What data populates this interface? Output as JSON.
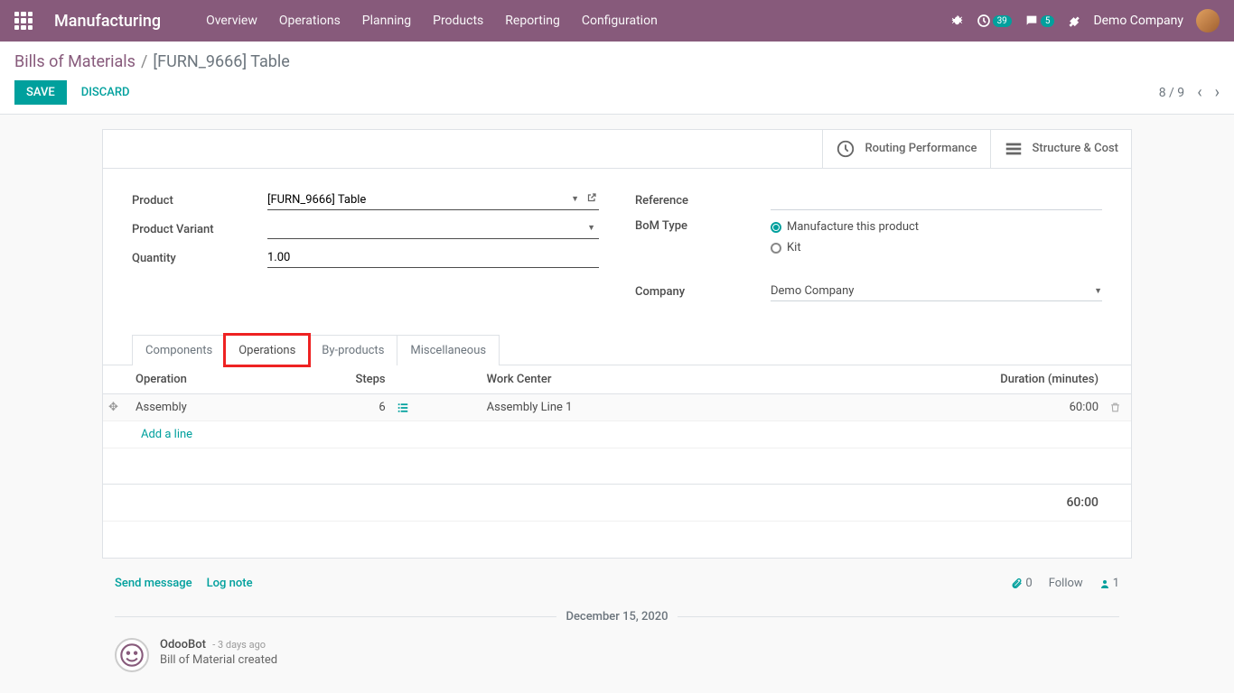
{
  "nav": {
    "brand": "Manufacturing",
    "menu": [
      "Overview",
      "Operations",
      "Planning",
      "Products",
      "Reporting",
      "Configuration"
    ],
    "badge_clock": "39",
    "badge_chat": "5",
    "company": "Demo Company"
  },
  "breadcrumb": {
    "root": "Bills of Materials",
    "current": "[FURN_9666] Table"
  },
  "buttons": {
    "save": "SAVE",
    "discard": "DISCARD"
  },
  "pager": {
    "text": "8 / 9"
  },
  "stat_buttons": {
    "routing": "Routing Performance",
    "structure": "Structure & Cost"
  },
  "fields": {
    "product": {
      "label": "Product",
      "value": "[FURN_9666] Table"
    },
    "variant": {
      "label": "Product Variant",
      "value": ""
    },
    "quantity": {
      "label": "Quantity",
      "value": "1.00"
    },
    "reference": {
      "label": "Reference",
      "value": ""
    },
    "bom_type": {
      "label": "BoM Type",
      "opt1": "Manufacture this product",
      "opt2": "Kit"
    },
    "company": {
      "label": "Company",
      "value": "Demo Company"
    }
  },
  "tabs": [
    "Components",
    "Operations",
    "By-products",
    "Miscellaneous"
  ],
  "ops": {
    "headers": {
      "operation": "Operation",
      "steps": "Steps",
      "workcenter": "Work Center",
      "duration": "Duration (minutes)"
    },
    "rows": [
      {
        "name": "Assembly",
        "steps": "6",
        "workcenter": "Assembly Line 1",
        "duration": "60:00"
      }
    ],
    "add_line": "Add a line",
    "total": "60:00"
  },
  "chatter": {
    "send": "Send message",
    "log": "Log note",
    "attach_count": "0",
    "follow": "Follow",
    "follower_count": "1",
    "date_sep": "December 15, 2020",
    "msg": {
      "author": "OdooBot",
      "time": "- 3 days ago",
      "content": "Bill of Material created"
    }
  }
}
